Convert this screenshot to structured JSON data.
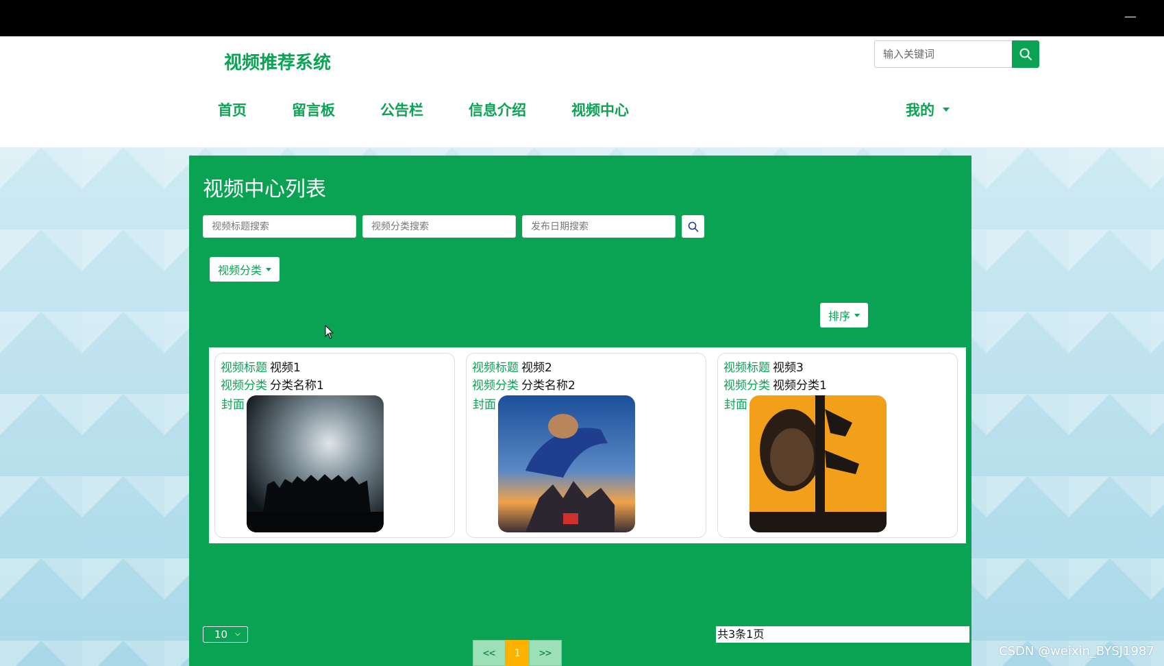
{
  "window": {
    "minimize_glyph": "—"
  },
  "header": {
    "brand": "视频推荐系统",
    "search_placeholder": "输入关键词",
    "search_icon": "search-icon",
    "nav": [
      "首页",
      "留言板",
      "公告栏",
      "信息介绍",
      "视频中心"
    ],
    "mine": "我的"
  },
  "panel": {
    "title": "视频中心列表",
    "filters": {
      "title_placeholder": "视频标题搜索",
      "category_placeholder": "视频分类搜索",
      "date_placeholder": "发布日期搜索"
    },
    "category_dropdown": "视频分类",
    "sort_dropdown": "排序",
    "label_title": "视频标题",
    "label_category": "视频分类",
    "label_cover": "封面",
    "cards": [
      {
        "title": "视频1",
        "category": "分类名称1",
        "cover": "mutant-chronicles-poster"
      },
      {
        "title": "视频2",
        "category": "分类名称2",
        "cover": "underdog-poster"
      },
      {
        "title": "视频3",
        "category": "视频分类1",
        "cover": "action-movie-poster"
      }
    ],
    "page_size": "10",
    "pager": {
      "prev": "<<",
      "current": "1",
      "next": ">>"
    },
    "total": "共3条1页"
  },
  "watermark": "CSDN @weixin_BYSJ1987",
  "colors": {
    "brand_green": "#0aa354",
    "pager_active": "#ffb100"
  }
}
